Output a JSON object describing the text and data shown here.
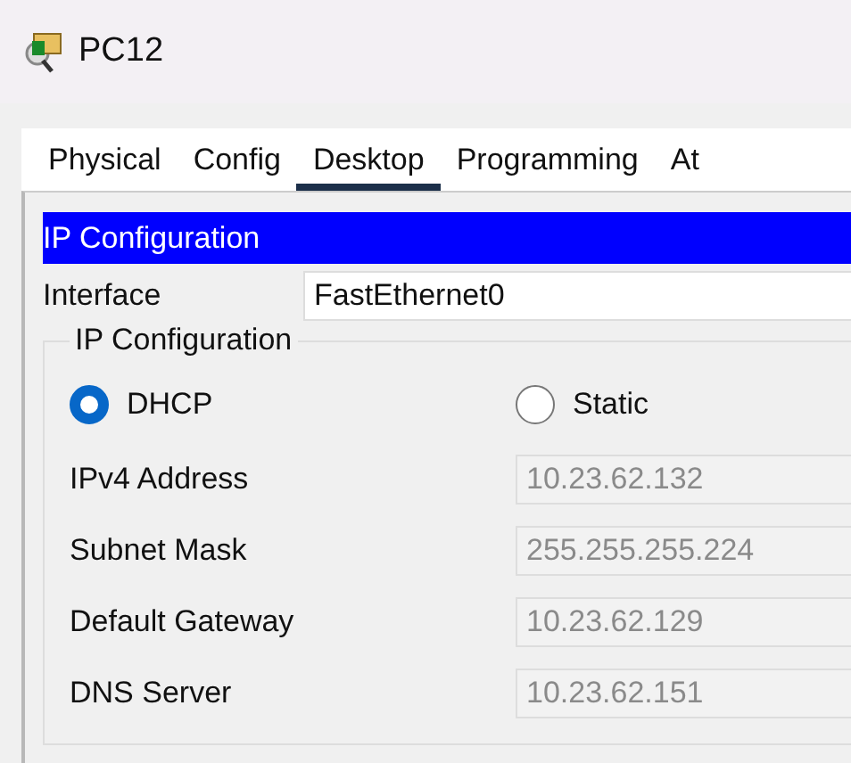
{
  "window": {
    "title": "PC12"
  },
  "tabs": [
    {
      "label": "Physical",
      "selected": false
    },
    {
      "label": "Config",
      "selected": false
    },
    {
      "label": "Desktop",
      "selected": true
    },
    {
      "label": "Programming",
      "selected": false
    },
    {
      "label": "At",
      "selected": false
    }
  ],
  "panel": {
    "header": "IP Configuration",
    "interface_label": "Interface",
    "interface_value": "FastEthernet0",
    "group": {
      "title": "IP Configuration",
      "modes": [
        {
          "label": "DHCP",
          "selected": true
        },
        {
          "label": "Static",
          "selected": false
        }
      ],
      "fields": [
        {
          "label": "IPv4 Address",
          "value": "10.23.62.132",
          "disabled": true
        },
        {
          "label": "Subnet Mask",
          "value": "255.255.255.224",
          "disabled": true
        },
        {
          "label": "Default Gateway",
          "value": "10.23.62.129",
          "disabled": true
        },
        {
          "label": "DNS Server",
          "value": "10.23.62.151",
          "disabled": true
        }
      ]
    }
  }
}
